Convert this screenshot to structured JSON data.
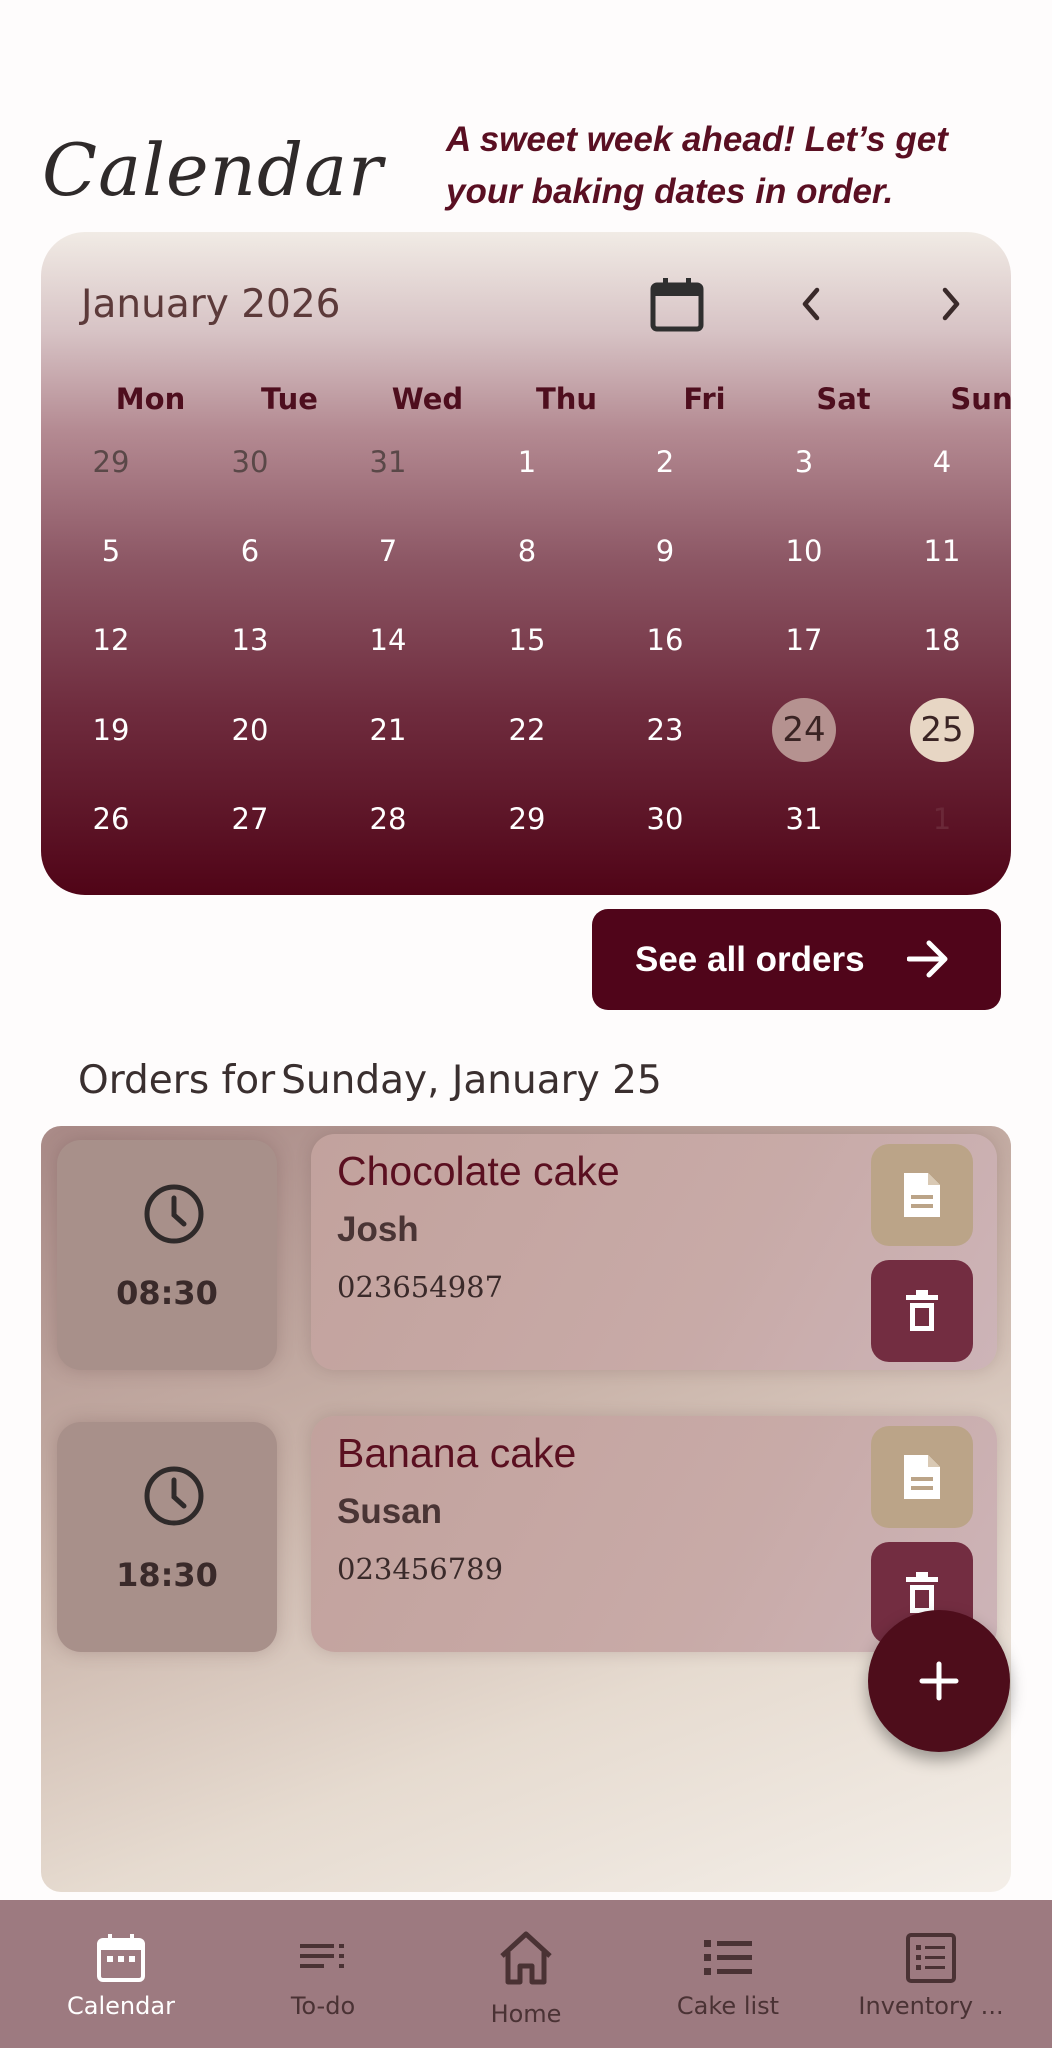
{
  "header": {
    "title": "Calendar",
    "tagline": "A sweet week ahead! Let’s get your baking dates in order."
  },
  "calendar": {
    "month_label": "January 2026",
    "weekdays": [
      "Mon",
      "Tue",
      "Wed",
      "Thu",
      "Fri",
      "Sat",
      "Sun"
    ],
    "weeks": [
      [
        "29",
        "30",
        "31",
        "1",
        "2",
        "3",
        "4"
      ],
      [
        "5",
        "6",
        "7",
        "8",
        "9",
        "10",
        "11"
      ],
      [
        "12",
        "13",
        "14",
        "15",
        "16",
        "17",
        "18"
      ],
      [
        "19",
        "20",
        "21",
        "22",
        "23",
        "24",
        "25"
      ],
      [
        "26",
        "27",
        "28",
        "29",
        "30",
        "31",
        "1"
      ]
    ],
    "highlighted_day": "24",
    "selected_day": "25"
  },
  "actions": {
    "see_all_orders": "See all orders"
  },
  "orders": {
    "heading_prefix": "Orders for",
    "heading_date": "Sunday, January 25",
    "items": [
      {
        "time": "08:30",
        "cake": "Chocolate cake",
        "customer": "Josh",
        "phone": "023654987"
      },
      {
        "time": "18:30",
        "cake": "Banana cake",
        "customer": "Susan",
        "phone": "023456789"
      }
    ]
  },
  "bottom_nav": {
    "items": [
      {
        "label": "Calendar",
        "icon": "calendar-icon",
        "active": true
      },
      {
        "label": "To-do",
        "icon": "todo-list-icon",
        "active": false
      },
      {
        "label": "Home",
        "icon": "home-icon",
        "active": false
      },
      {
        "label": "Cake list",
        "icon": "list-icon",
        "active": false
      },
      {
        "label": "Inventory ...",
        "icon": "inventory-icon",
        "active": false
      }
    ]
  },
  "colors": {
    "accent": "#50051a",
    "nav_background": "#9d7a80",
    "doc_button": "#bba488",
    "delete_button": "#732d41"
  }
}
